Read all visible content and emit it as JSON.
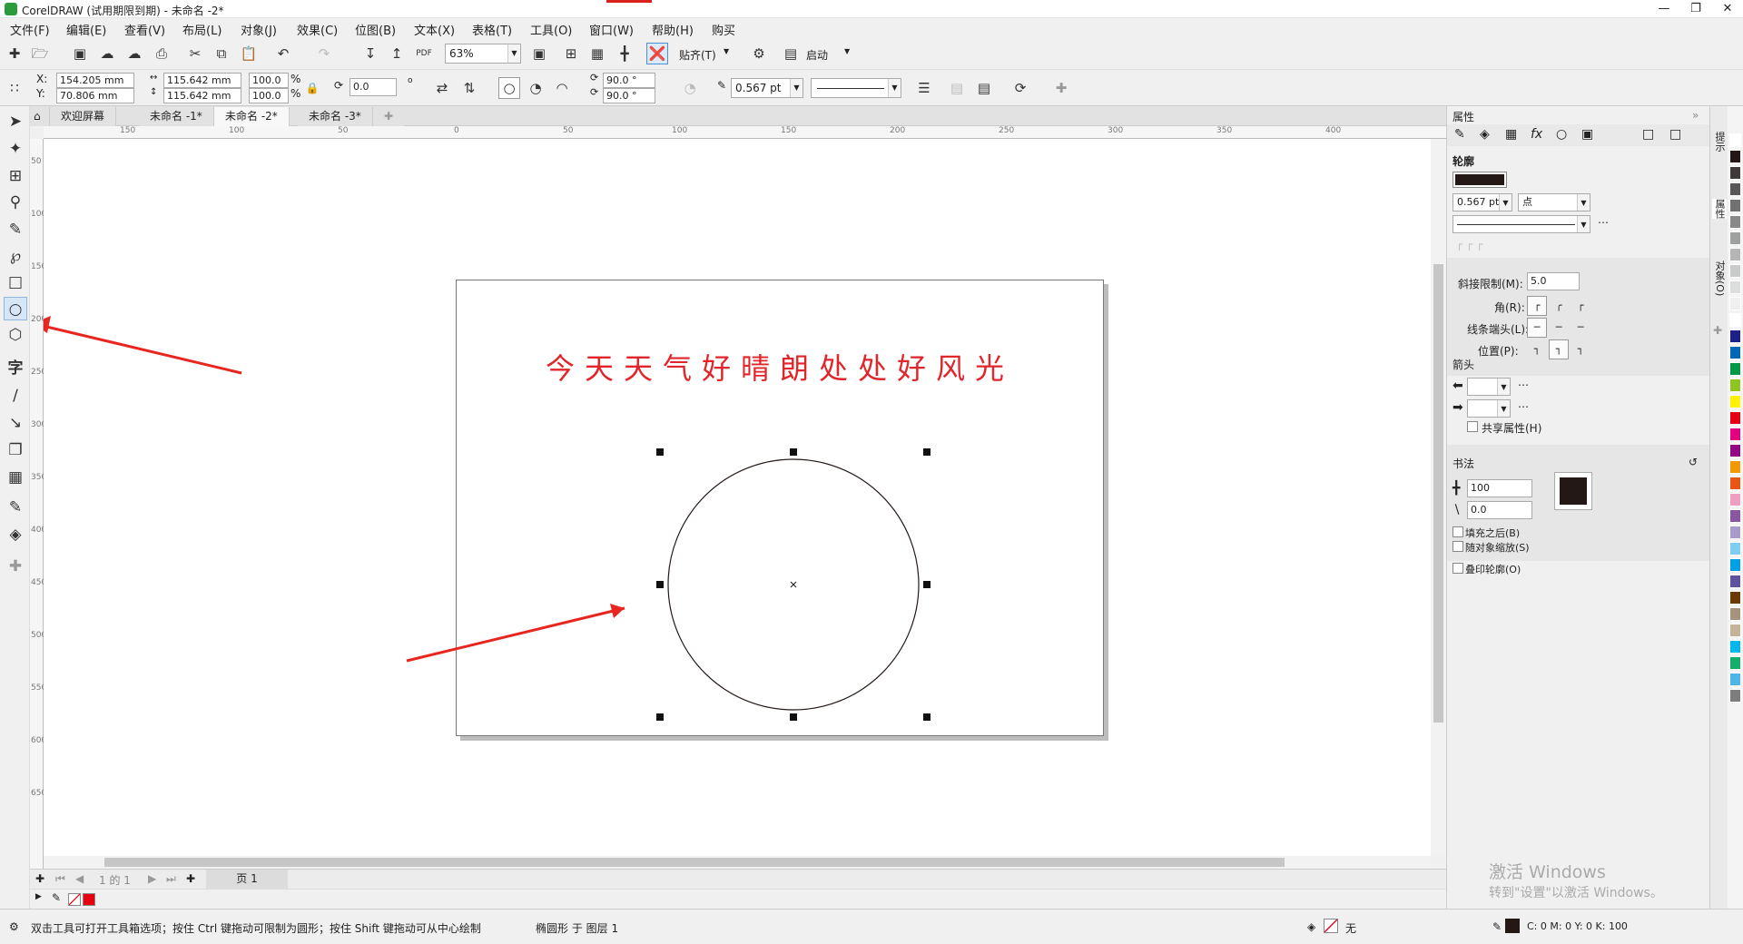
{
  "title": "CorelDRAW (试用期限到期) - 未命名 -2*",
  "menu": [
    "文件(F)",
    "编辑(E)",
    "查看(V)",
    "布局(L)",
    "对象(J)",
    "效果(C)",
    "位图(B)",
    "文本(X)",
    "表格(T)",
    "工具(O)",
    "窗口(W)",
    "帮助(H)",
    "购买"
  ],
  "toolbar": {
    "zoom": "63%",
    "snap": "贴齐(T)",
    "launch": "启动"
  },
  "property_bar": {
    "x": "154.205 mm",
    "y": "70.806 mm",
    "w": "115.642 mm",
    "h": "115.642 mm",
    "scale_w": "100.0",
    "scale_h": "100.0",
    "percent": "%",
    "rotation": "0.0",
    "angle_start": "90.0 °",
    "angle_end": "90.0 °",
    "outline_width": "0.567 pt",
    "x_label": "X:",
    "y_label": "Y:"
  },
  "tabs": [
    "欢迎屏幕",
    "未命名 -1*",
    "未命名 -2*",
    "未命名 -3*"
  ],
  "active_tab_index": 2,
  "ruler_h": [
    "150",
    "100",
    "50",
    "0",
    "50",
    "100",
    "150",
    "200",
    "250",
    "300",
    "350",
    "400"
  ],
  "ruler_v": [
    "50",
    "100",
    "150",
    "200",
    "250",
    "300",
    "350",
    "400",
    "450",
    "500",
    "550",
    "600",
    "650"
  ],
  "canvas_text": "今天天气好晴朗处处好风光",
  "page_nav": {
    "counter": "1 的 1",
    "page_tab": "页 1"
  },
  "status": {
    "hint": "双击工具可打开工具箱选项；按住 Ctrl 键拖动可限制为圆形；按住 Shift 键拖动可从中心绘制",
    "object": "椭圆形 于 图层 1",
    "fill": "无",
    "outline": "C: 0 M: 0 Y: 0 K: 100"
  },
  "panel": {
    "header": "属性",
    "outline_title": "轮廓",
    "width": "0.567 pt",
    "unit": "点",
    "miter_label": "斜接限制(M):",
    "miter": "5.0",
    "corner_label": "角(R):",
    "cap_label": "线条端头(L):",
    "position_label": "位置(P):",
    "arrow_title": "箭头",
    "share_label": "共享属性(H)",
    "calligraphy_title": "书法",
    "stretch": "100",
    "angle": "0.0",
    "fill_behind": "填充之后(B)",
    "scale_with": "随对象缩放(S)",
    "overprint": "叠印轮廓(O)"
  },
  "dock_tabs": [
    "提示",
    "属性",
    "对象(O)"
  ],
  "watermark": {
    "line1": "激活 Windows",
    "line2": "转到\"设置\"以激活 Windows。"
  },
  "colors": {
    "accent_red": "#e0262b",
    "outline_color": "#231815"
  },
  "palette": [
    "#ffffff",
    "#231815",
    "#3e3a39",
    "#595757",
    "#727171",
    "#898989",
    "#9fa0a0",
    "#b5b5b6",
    "#c9caca",
    "#dcdddd",
    "#efefef",
    "#ffffff",
    "#1d2088",
    "#0068b7",
    "#009944",
    "#8fc31f",
    "#fff100",
    "#e60012",
    "#e4007f",
    "#920783",
    "#f39800",
    "#ea5514",
    "#f19ec2",
    "#8957a1",
    "#a99bc9",
    "#7ecef4",
    "#00a0e9",
    "#5f52a0",
    "#6a3906",
    "#a6937c",
    "#c7b299",
    "#00b7ee",
    "#13ae67",
    "#4cb4e7",
    "#7d7d7d"
  ]
}
